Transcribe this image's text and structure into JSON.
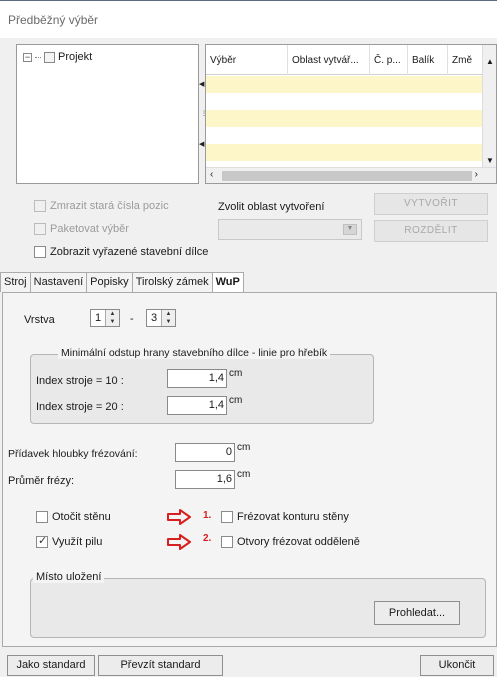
{
  "window": {
    "title": "Předběžný výběr"
  },
  "tree": {
    "root_label": "Projekt"
  },
  "grid": {
    "columns": [
      "Výběr",
      "Oblast vytvář...",
      "Č. p...",
      "Balík",
      "Změ"
    ]
  },
  "options_top": {
    "freeze_old_numbers": "Zmrazit stará čísla pozic",
    "package_selection": "Paketovat výběr",
    "show_excluded": "Zobrazit vyřazené stavební dílce",
    "choose_area_label": "Zvolit oblast vytvoření",
    "create_button": "VYTVOŘIT",
    "split_button": "ROZDĚLIT"
  },
  "tabs": [
    "Stroj",
    "Nastavení",
    "Popisky",
    "Tirolský zámek",
    "WuP"
  ],
  "active_tab": "WuP",
  "wup": {
    "layer_label": "Vrstva",
    "layer_from": "1",
    "layer_dash": "-",
    "layer_to": "3",
    "group_title": "Minimální odstup hrany stavebního dílce - linie pro hřebík",
    "index10_label": "Index stroje = 10 :",
    "index10_value": "1,4",
    "index20_label": "Index stroje = 20 :",
    "index20_value": "1,4",
    "unit_cm": "cm",
    "milling_depth_label": "Přídavek hloubky frézování:",
    "milling_depth_value": "0",
    "cutter_diameter_label": "Průměr frézy:",
    "cutter_diameter_value": "1,6",
    "rotate_wall": "Otočit stěnu",
    "use_saw": "Využít pilu",
    "mark1": "1.",
    "mark2": "2.",
    "mill_wall_contour": "Frézovat konturu stěny",
    "mill_openings_separately": "Otvory frézovat odděleně",
    "storage_group": "Místo uložení",
    "browse_button": "Prohledat..."
  },
  "footer": {
    "as_standard": "Jako standard",
    "take_standard": "Převzít standard",
    "finish": "Ukončit"
  },
  "colors": {
    "highlight_row": "#fdf6c8",
    "red_mark": "#d81f1f"
  }
}
